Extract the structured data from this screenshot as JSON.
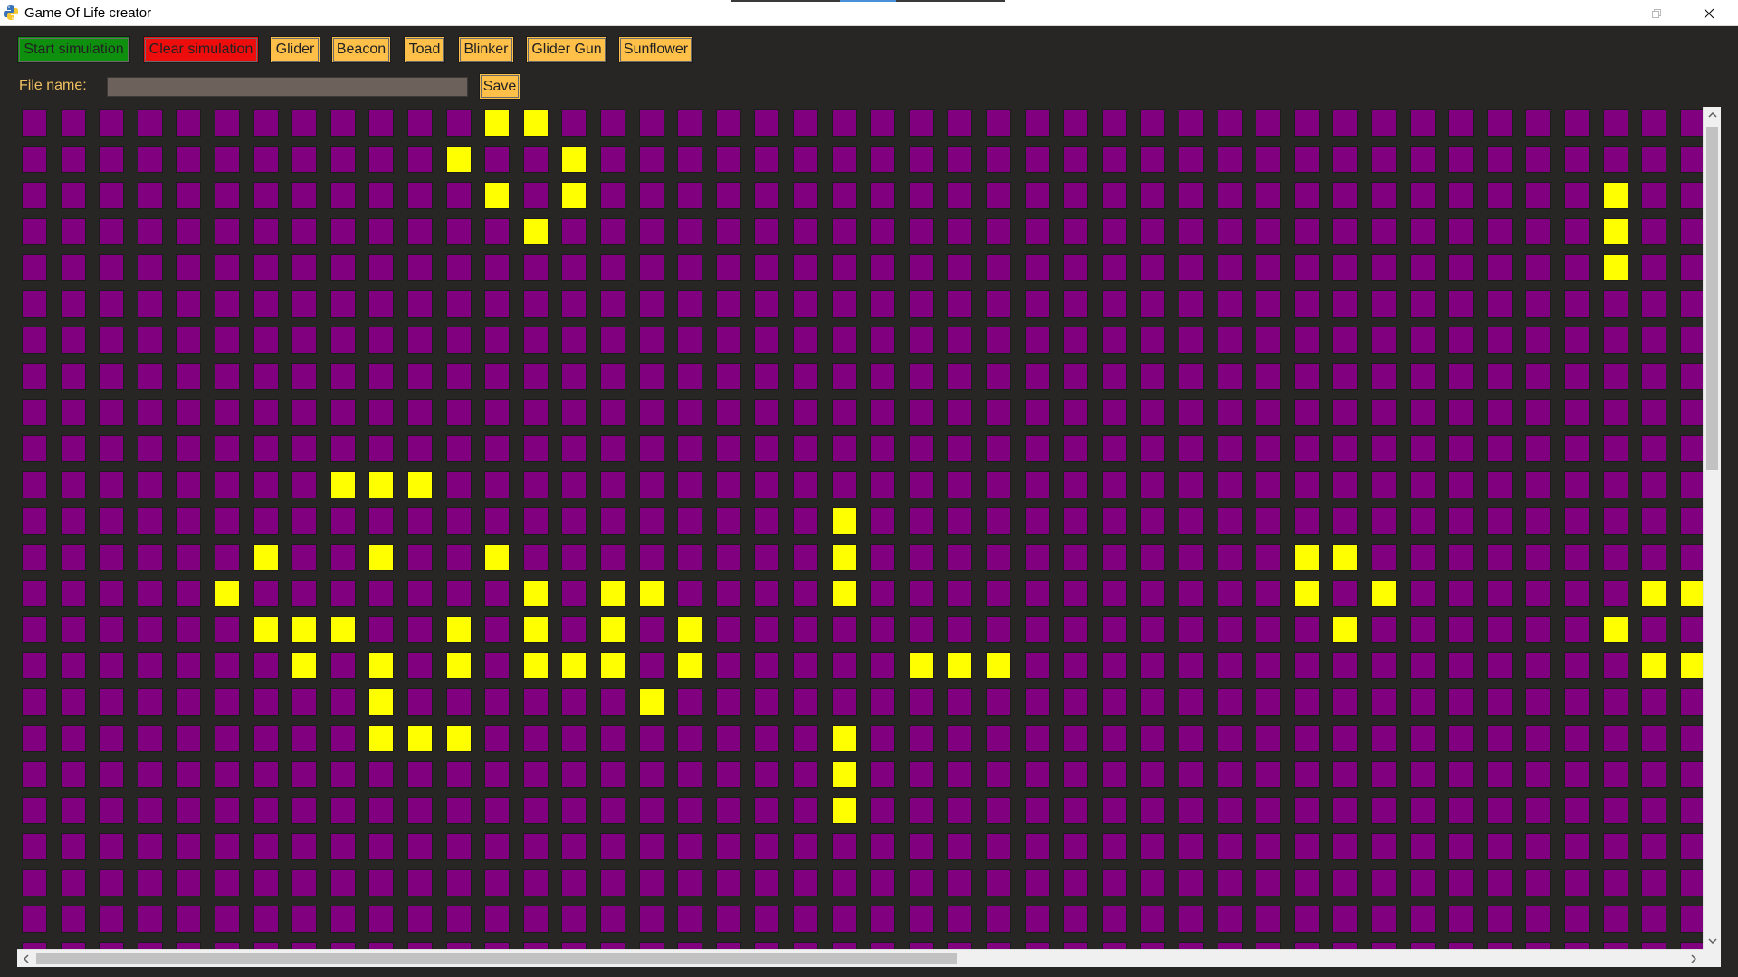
{
  "window": {
    "title": "Game Of Life creator",
    "icon": "python-logo-icon",
    "controls": [
      "minimize-icon",
      "maximize-icon",
      "close-icon"
    ]
  },
  "toolbar": {
    "start_label": "Start simulation",
    "clear_label": "Clear simulation",
    "presets": [
      {
        "key": "glider",
        "label": "Glider"
      },
      {
        "key": "beacon",
        "label": "Beacon"
      },
      {
        "key": "toad",
        "label": "Toad"
      },
      {
        "key": "blinker",
        "label": "Blinker"
      },
      {
        "key": "gliderGun",
        "label": "Glider Gun"
      },
      {
        "key": "sunflower",
        "label": "Sunflower"
      }
    ],
    "colors": {
      "start": "#0e8f0e",
      "clear": "#ee0d0d",
      "preset": "#ffc04a"
    }
  },
  "file": {
    "label": "File name:",
    "value": "",
    "save_label": "Save"
  },
  "grid": {
    "visible_cols": 44,
    "visible_rows": 23,
    "dead_color": "#800080",
    "alive_color": "#ffff00",
    "alive_cells": [
      [
        0,
        12
      ],
      [
        0,
        13
      ],
      [
        1,
        11
      ],
      [
        1,
        14
      ],
      [
        2,
        12
      ],
      [
        2,
        14
      ],
      [
        2,
        41
      ],
      [
        3,
        13
      ],
      [
        3,
        41
      ],
      [
        4,
        41
      ],
      [
        10,
        8
      ],
      [
        10,
        9
      ],
      [
        10,
        10
      ],
      [
        11,
        21
      ],
      [
        12,
        6
      ],
      [
        12,
        9
      ],
      [
        12,
        12
      ],
      [
        12,
        21
      ],
      [
        12,
        33
      ],
      [
        12,
        34
      ],
      [
        13,
        5
      ],
      [
        13,
        13
      ],
      [
        13,
        15
      ],
      [
        13,
        16
      ],
      [
        13,
        21
      ],
      [
        13,
        33
      ],
      [
        13,
        35
      ],
      [
        13,
        42
      ],
      [
        13,
        43
      ],
      [
        14,
        6
      ],
      [
        14,
        7
      ],
      [
        14,
        8
      ],
      [
        14,
        11
      ],
      [
        14,
        13
      ],
      [
        14,
        15
      ],
      [
        14,
        17
      ],
      [
        14,
        34
      ],
      [
        14,
        41
      ],
      [
        15,
        7
      ],
      [
        15,
        9
      ],
      [
        15,
        11
      ],
      [
        15,
        13
      ],
      [
        15,
        14
      ],
      [
        15,
        15
      ],
      [
        15,
        17
      ],
      [
        15,
        23
      ],
      [
        15,
        24
      ],
      [
        15,
        25
      ],
      [
        15,
        42
      ],
      [
        15,
        43
      ],
      [
        16,
        9
      ],
      [
        16,
        16
      ],
      [
        17,
        9
      ],
      [
        17,
        10
      ],
      [
        17,
        11
      ],
      [
        17,
        21
      ],
      [
        18,
        21
      ],
      [
        19,
        21
      ]
    ]
  },
  "scrollbars": {
    "vertical_position": 0.0,
    "horizontal_position": 0.0
  }
}
